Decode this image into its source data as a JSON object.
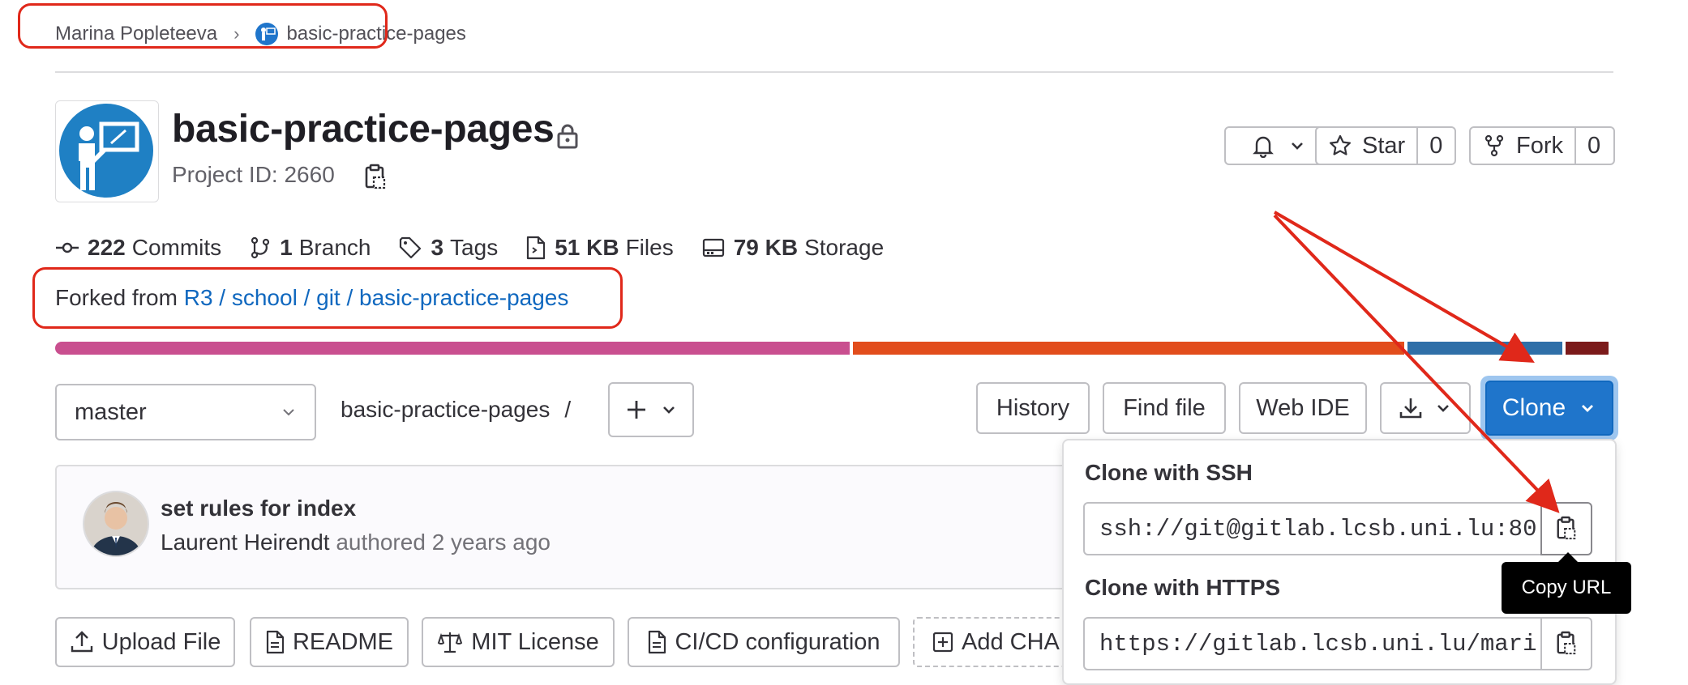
{
  "breadcrumb": {
    "owner": "Marina Popleteeva",
    "project": "basic-practice-pages"
  },
  "project": {
    "title": "basic-practice-pages",
    "id_label": "Project ID: 2660"
  },
  "actions": {
    "star_label": "Star",
    "star_count": "0",
    "fork_label": "Fork",
    "fork_count": "0"
  },
  "stats": {
    "commits": {
      "value": "222",
      "label": "Commits"
    },
    "branches": {
      "value": "1",
      "label": "Branch"
    },
    "tags": {
      "value": "3",
      "label": "Tags"
    },
    "files": {
      "value": "51 KB",
      "label": "Files"
    },
    "storage": {
      "value": "79 KB",
      "label": "Storage"
    }
  },
  "forked": {
    "prefix": "Forked from",
    "link": "R3 / school / git / basic-practice-pages"
  },
  "language_bar": [
    {
      "color": "#c94f8f",
      "share": 0.513
    },
    {
      "color": "#e24d1c",
      "share": 0.356
    },
    {
      "color": "#2f6fa8",
      "share": 0.1
    },
    {
      "color": "#7b1a1a",
      "share": 0.028
    }
  ],
  "toolbar": {
    "branch": "master",
    "path": "basic-practice-pages",
    "path_sep": "/",
    "history": "History",
    "find_file": "Find file",
    "web_ide": "Web IDE",
    "clone": "Clone"
  },
  "clone_panel": {
    "ssh_title": "Clone with SSH",
    "ssh_url": "ssh://git@gitlab.lcsb.uni.lu:80",
    "https_title": "Clone with HTTPS",
    "https_url": "https://gitlab.lcsb.uni.lu/mari",
    "tooltip": "Copy URL"
  },
  "commit": {
    "title": "set rules for index",
    "author": "Laurent Heirendt",
    "authored": "authored",
    "time": "2 years ago"
  },
  "bottom_buttons": {
    "upload": "Upload File",
    "readme": "README",
    "license": "MIT License",
    "cicd": "CI/CD configuration",
    "add": "Add CHA"
  },
  "colors": {
    "accent": "#1f75cb",
    "annotation": "#e0281a",
    "link": "#1068bf"
  }
}
